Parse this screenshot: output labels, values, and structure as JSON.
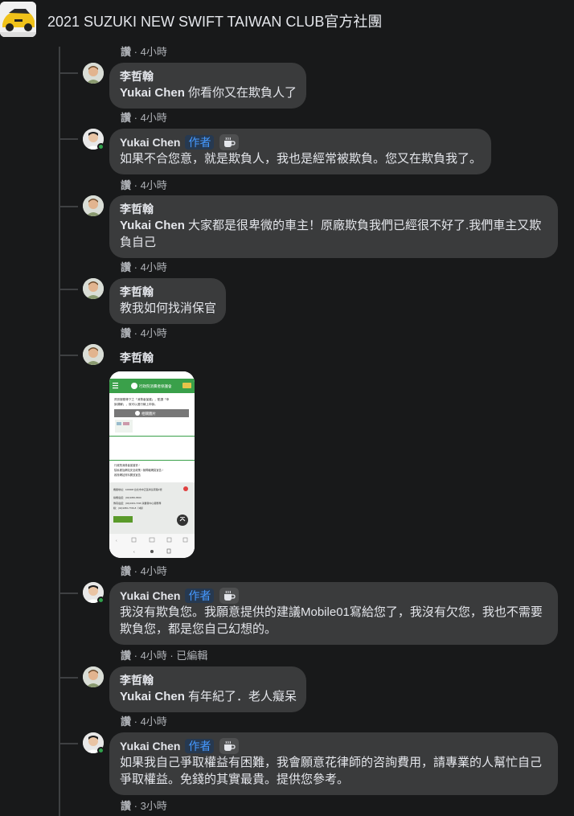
{
  "header": {
    "group_title": "2021 SUZUKI NEW SWIFT TAIWAN CLUB官方社團"
  },
  "top_meta": {
    "like_label": "讚",
    "time": "4小時"
  },
  "comments": [
    {
      "name": "李哲翰",
      "mention": "Yukai Chen",
      "text": " 你看你又在欺負人了",
      "like_label": "讚",
      "time": "4小時"
    },
    {
      "name": "Yukai Chen",
      "author_label": "作者",
      "text": "如果不合您意，就是欺負人，我也是經常被欺負。您又在欺負我了。",
      "like_label": "讚",
      "time": "4小時"
    },
    {
      "name": "李哲翰",
      "mention": "Yukai Chen",
      "text": " 大家都是很卑微的車主！原廠欺負我們已經很不好了.我們車主又欺負自己",
      "like_label": "讚",
      "time": "4小時"
    },
    {
      "name": "李哲翰",
      "text": "教我如何找消保官",
      "like_label": "讚",
      "time": "4小時"
    },
    {
      "name": "李哲翰",
      "like_label": "讚",
      "time": "4小時",
      "attachment": {
        "site_title": "行政院消費者保護會",
        "body_line1": "資訊服務等下之「消費者保護」，點選「申",
        "body_line2": "訴調解」，就可以進行線上申訴。",
        "banner": "相關圖片",
        "footer_line1": "行政院消費者保護會 /",
        "footer_line2": "隱私權及網站安全政策 / 無障礙網頁宣告 /",
        "footer_line3": "政府網站資料開放宣告",
        "address": "機關地址：100008 台北市中正區青島東路1號",
        "phone1": "總機電話：(02)3356-6500",
        "phone2": "傳真電話：(02)2343-7196 消費者中心服務專",
        "phone3": "線：(02)3356-7766-8（3線）"
      }
    },
    {
      "name": "Yukai Chen",
      "author_label": "作者",
      "text": "我沒有欺負您。我願意提供的建議Mobile01寫給您了，我沒有欠您，我也不需要欺負您，都是您自己幻想的。",
      "like_label": "讚",
      "time": "4小時",
      "edited": "已編輯"
    },
    {
      "name": "李哲翰",
      "mention": "Yukai Chen",
      "text": " 有年紀了．老人癡呆",
      "like_label": "讚",
      "time": "4小時"
    },
    {
      "name": "Yukai Chen",
      "author_label": "作者",
      "text": "如果我自己爭取權益有困難，我會願意花律師的咨詢費用，請專業的人幫忙自己爭取權益。免錢的其實最貴。提供您參考。",
      "like_label": "讚",
      "time": "3小時"
    }
  ],
  "icons": {
    "coffee_badge": "coffee-cup-icon",
    "online": "online-status-icon"
  },
  "colors": {
    "background": "#18191a",
    "bubble": "#3a3b3c",
    "author_badge_text": "#4599ff",
    "meta_text": "#b0b3b8",
    "online": "#31a24c"
  }
}
